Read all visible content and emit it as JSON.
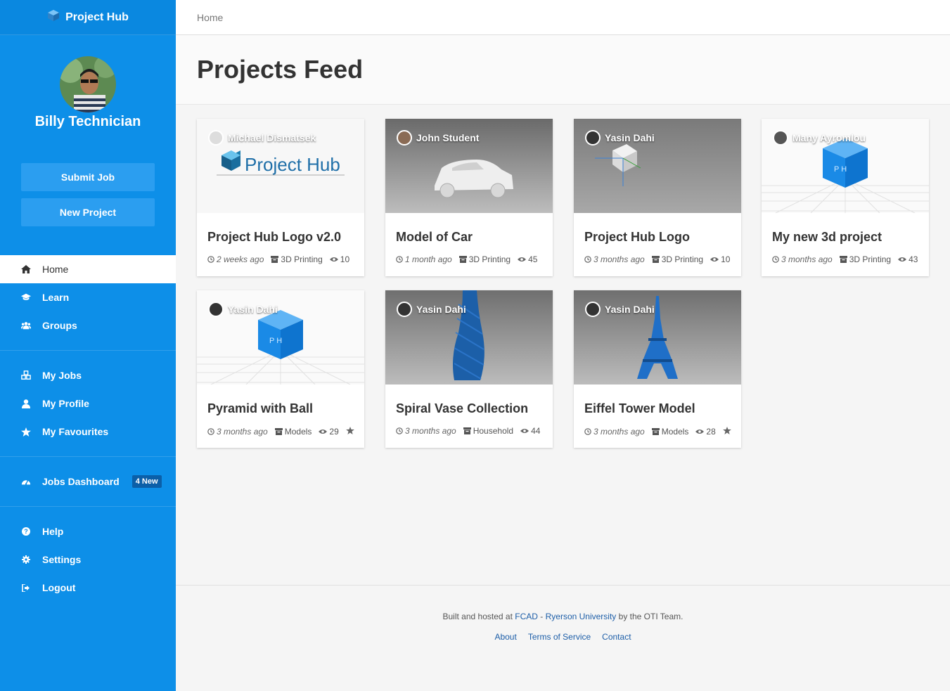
{
  "app": {
    "brand": "Project Hub"
  },
  "user": {
    "name": "Billy Technician"
  },
  "sidebar": {
    "submit_job": "Submit Job",
    "new_project": "New Project",
    "home": "Home",
    "learn": "Learn",
    "groups": "Groups",
    "my_jobs": "My Jobs",
    "my_profile": "My Profile",
    "my_favourites": "My Favourites",
    "jobs_dashboard": "Jobs Dashboard",
    "jobs_badge": "4 New",
    "help": "Help",
    "settings": "Settings",
    "logout": "Logout"
  },
  "breadcrumb": "Home",
  "page_title": "Projects Feed",
  "thumb_texts": {
    "logo_text": "Project Hub",
    "cube_letters": "P H"
  },
  "cards": [
    {
      "author": "Michael Dismatsek",
      "title": "Project Hub Logo v2.0",
      "time": "2 weeks ago",
      "category": "3D Printing",
      "views": "10"
    },
    {
      "author": "John Student",
      "title": "Model of Car",
      "time": "1 month ago",
      "category": "3D Printing",
      "views": "45"
    },
    {
      "author": "Yasin Dahi",
      "title": "Project Hub Logo",
      "time": "3 months ago",
      "category": "3D Printing",
      "views": "10"
    },
    {
      "author": "Many Ayromlou",
      "title": "My new 3d project",
      "time": "3 months ago",
      "category": "3D Printing",
      "views": "43"
    },
    {
      "author": "Yasin Dahi",
      "title": "Pyramid with Ball",
      "time": "3 months ago",
      "category": "Models",
      "views": "29"
    },
    {
      "author": "Yasin Dahi",
      "title": "Spiral Vase Collection",
      "time": "3 months ago",
      "category": "Household",
      "views": "44"
    },
    {
      "author": "Yasin Dahi",
      "title": "Eiffel Tower Model",
      "time": "3 months ago",
      "category": "Models",
      "views": "28"
    }
  ],
  "footer": {
    "prefix": "Built and hosted at",
    "org1": "FCAD",
    "dash": "-",
    "org2": "Ryerson University",
    "suffix": "by the OTI Team.",
    "about": "About",
    "terms": "Terms of Service",
    "contact": "Contact"
  },
  "colors": {
    "sidebar": "#0d8fe8",
    "accent": "#1d5ea8",
    "button": "#2b9ef0"
  }
}
